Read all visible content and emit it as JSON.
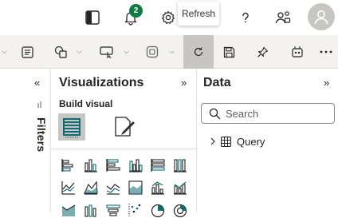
{
  "header": {
    "notification_count": "2",
    "icons": [
      "sidebar-toggle-icon",
      "bell-icon",
      "gear-icon",
      "help-icon",
      "share-people-icon",
      "user-icon"
    ]
  },
  "tooltip": {
    "text": "Refresh"
  },
  "ribbon": {
    "icons": [
      "note-icon",
      "shapes-icon",
      "buttons-icon",
      "visual-icon",
      "refresh-icon",
      "save-icon",
      "pin-icon",
      "copilot-icon",
      "more-icon"
    ]
  },
  "filters": {
    "label": "Filters",
    "collapse_glyph": "«"
  },
  "visualizations": {
    "title": "Visualizations",
    "expand_glyph": "»",
    "build_visual_label": "Build visual"
  },
  "data": {
    "title": "Data",
    "expand_glyph": "»",
    "search_placeholder": "Search",
    "tree": [
      {
        "label": "Query"
      }
    ]
  },
  "colors": {
    "teal": "#0f6c74",
    "tile_gray": "#c8c6c4",
    "badge": "#107c41",
    "ribbon_bg": "#f3f2f1"
  }
}
